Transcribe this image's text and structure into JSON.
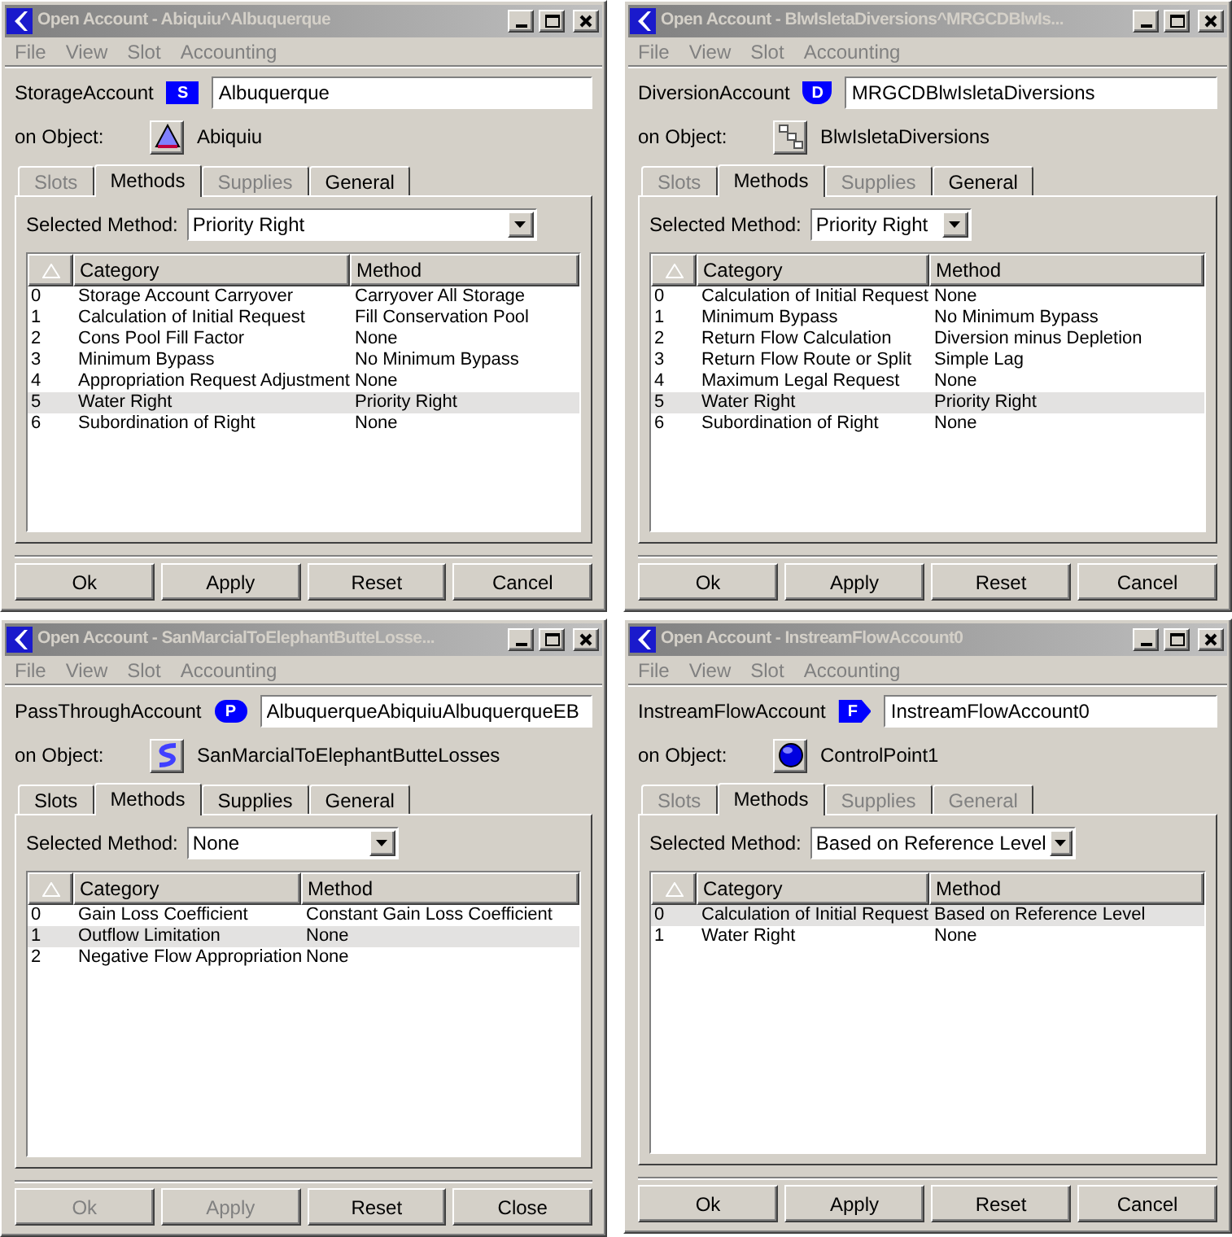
{
  "windows": [
    {
      "title": "Open Account - Abiquiu^Albuquerque",
      "menu": [
        "File",
        "View",
        "Slot",
        "Accounting"
      ],
      "account": {
        "type_label": "StorageAccount",
        "badge": {
          "kind": "square",
          "letter": "S"
        },
        "name": "Albuquerque"
      },
      "object": {
        "label": "on Object:",
        "kind": "reservoir",
        "name": "Abiquiu"
      },
      "tabs": [
        {
          "label": "Slots",
          "selected": false,
          "disabled": true
        },
        {
          "label": "Methods",
          "selected": true,
          "disabled": false
        },
        {
          "label": "Supplies",
          "selected": false,
          "disabled": true
        },
        {
          "label": "General",
          "selected": false,
          "disabled": false
        }
      ],
      "selected_method": {
        "label": "Selected Method:",
        "value": "Priority Right"
      },
      "table": {
        "columns": [
          "Category",
          "Method"
        ],
        "rows": [
          {
            "index": "0",
            "category": "Storage Account Carryover",
            "method": "Carryover All Storage",
            "selected": false
          },
          {
            "index": "1",
            "category": "Calculation of Initial Request",
            "method": "Fill Conservation Pool",
            "selected": false
          },
          {
            "index": "2",
            "category": "Cons Pool Fill Factor",
            "method": "None",
            "selected": false
          },
          {
            "index": "3",
            "category": "Minimum Bypass",
            "method": "No Minimum Bypass",
            "selected": false
          },
          {
            "index": "4",
            "category": "Appropriation Request Adjustment",
            "method": "None",
            "selected": false
          },
          {
            "index": "5",
            "category": "Water Right",
            "method": "Priority Right",
            "selected": true
          },
          {
            "index": "6",
            "category": "Subordination of Right",
            "method": "None",
            "selected": false
          }
        ]
      },
      "buttons": [
        {
          "label": "Ok",
          "disabled": false
        },
        {
          "label": "Apply",
          "disabled": false
        },
        {
          "label": "Reset",
          "disabled": false
        },
        {
          "label": "Cancel",
          "disabled": false
        }
      ]
    },
    {
      "title": "Open Account - BlwIsletaDiversions^MRGCDBlwIs...",
      "menu": [
        "File",
        "View",
        "Slot",
        "Accounting"
      ],
      "account": {
        "type_label": "DiversionAccount",
        "badge": {
          "kind": "shield",
          "letter": "D"
        },
        "name": "MRGCDBlwIsletaDiversions"
      },
      "object": {
        "label": "on Object:",
        "kind": "diversion",
        "name": "BlwIsletaDiversions"
      },
      "tabs": [
        {
          "label": "Slots",
          "selected": false,
          "disabled": true
        },
        {
          "label": "Methods",
          "selected": true,
          "disabled": false
        },
        {
          "label": "Supplies",
          "selected": false,
          "disabled": true
        },
        {
          "label": "General",
          "selected": false,
          "disabled": false
        }
      ],
      "selected_method": {
        "label": "Selected Method:",
        "value": "Priority Right"
      },
      "table": {
        "columns": [
          "Category",
          "Method"
        ],
        "rows": [
          {
            "index": "0",
            "category": "Calculation of Initial Request",
            "method": "None",
            "selected": false
          },
          {
            "index": "1",
            "category": "Minimum Bypass",
            "method": "No Minimum Bypass",
            "selected": false
          },
          {
            "index": "2",
            "category": "Return Flow Calculation",
            "method": "Diversion minus Depletion",
            "selected": false
          },
          {
            "index": "3",
            "category": "Return Flow Route or Split",
            "method": "Simple Lag",
            "selected": false
          },
          {
            "index": "4",
            "category": "Maximum Legal Request",
            "method": "None",
            "selected": false
          },
          {
            "index": "5",
            "category": "Water Right",
            "method": "Priority Right",
            "selected": true
          },
          {
            "index": "6",
            "category": "Subordination of Right",
            "method": "None",
            "selected": false
          }
        ]
      },
      "buttons": [
        {
          "label": "Ok",
          "disabled": false
        },
        {
          "label": "Apply",
          "disabled": false
        },
        {
          "label": "Reset",
          "disabled": false
        },
        {
          "label": "Cancel",
          "disabled": false
        }
      ]
    },
    {
      "title": "Open Account - SanMarcialToElephantButteLosse...",
      "menu": [
        "File",
        "View",
        "Slot",
        "Accounting"
      ],
      "account": {
        "type_label": "PassThroughAccount",
        "badge": {
          "kind": "oval",
          "letter": "P"
        },
        "name": "AlbuquerqueAbiquiuAlbuquerqueEB"
      },
      "object": {
        "label": "on Object:",
        "kind": "reach",
        "name": "SanMarcialToElephantButteLosses"
      },
      "tabs": [
        {
          "label": "Slots",
          "selected": false,
          "disabled": false
        },
        {
          "label": "Methods",
          "selected": true,
          "disabled": false
        },
        {
          "label": "Supplies",
          "selected": false,
          "disabled": false
        },
        {
          "label": "General",
          "selected": false,
          "disabled": false
        }
      ],
      "selected_method": {
        "label": "Selected Method:",
        "value": "None"
      },
      "table": {
        "columns": [
          "Category",
          "Method"
        ],
        "rows": [
          {
            "index": "0",
            "category": "Gain Loss Coefficient",
            "method": "Constant Gain Loss Coefficient",
            "selected": false
          },
          {
            "index": "1",
            "category": "Outflow Limitation",
            "method": "None",
            "selected": true
          },
          {
            "index": "2",
            "category": "Negative Flow Appropriation",
            "method": "None",
            "selected": false
          }
        ]
      },
      "buttons": [
        {
          "label": "Ok",
          "disabled": true
        },
        {
          "label": "Apply",
          "disabled": true
        },
        {
          "label": "Reset",
          "disabled": false
        },
        {
          "label": "Close",
          "disabled": false
        }
      ]
    },
    {
      "title": "Open Account - InstreamFlowAccount0",
      "menu": [
        "File",
        "View",
        "Slot",
        "Accounting"
      ],
      "account": {
        "type_label": "InstreamFlowAccount",
        "badge": {
          "kind": "arrow",
          "letter": "F"
        },
        "name": "InstreamFlowAccount0"
      },
      "object": {
        "label": "on Object:",
        "kind": "control_point",
        "name": "ControlPoint1"
      },
      "tabs": [
        {
          "label": "Slots",
          "selected": false,
          "disabled": true
        },
        {
          "label": "Methods",
          "selected": true,
          "disabled": false
        },
        {
          "label": "Supplies",
          "selected": false,
          "disabled": true
        },
        {
          "label": "General",
          "selected": false,
          "disabled": true
        }
      ],
      "selected_method": {
        "label": "Selected Method:",
        "value": "Based on Reference Level"
      },
      "table": {
        "columns": [
          "Category",
          "Method"
        ],
        "rows": [
          {
            "index": "0",
            "category": "Calculation of Initial Request",
            "method": "Based on Reference Level",
            "selected": true
          },
          {
            "index": "1",
            "category": "Water Right",
            "method": "None",
            "selected": false
          }
        ]
      },
      "buttons": [
        {
          "label": "Ok",
          "disabled": false
        },
        {
          "label": "Apply",
          "disabled": false
        },
        {
          "label": "Reset",
          "disabled": false
        },
        {
          "label": "Cancel",
          "disabled": false
        }
      ]
    }
  ]
}
